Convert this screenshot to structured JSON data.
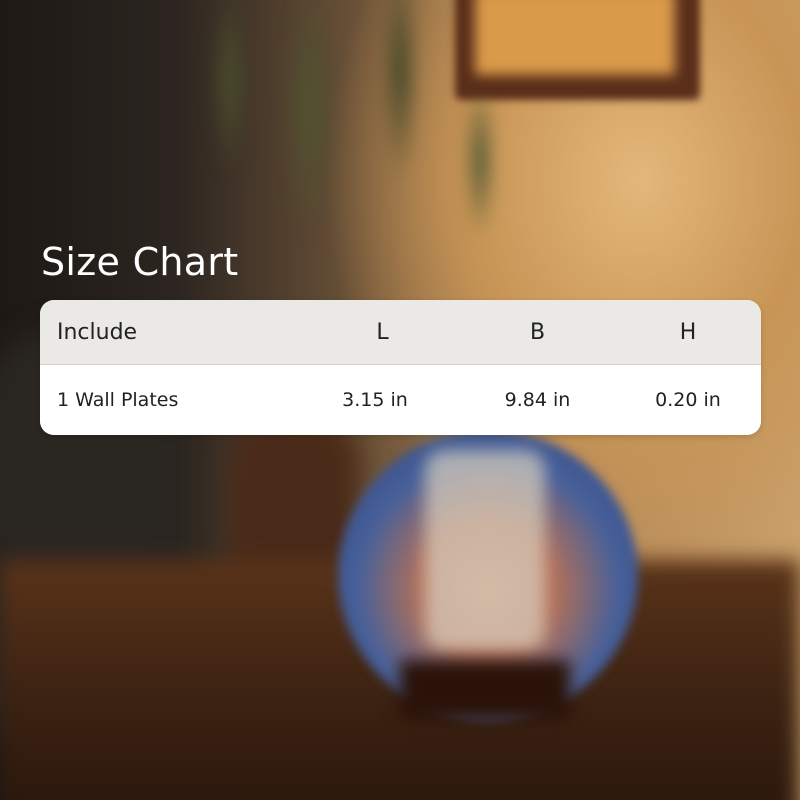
{
  "title": "Size Chart",
  "table": {
    "headers": [
      "Include",
      "L",
      "B",
      "H"
    ],
    "rows": [
      [
        "1 Wall Plates",
        "3.15 in",
        "9.84 in",
        "0.20 in"
      ]
    ]
  }
}
